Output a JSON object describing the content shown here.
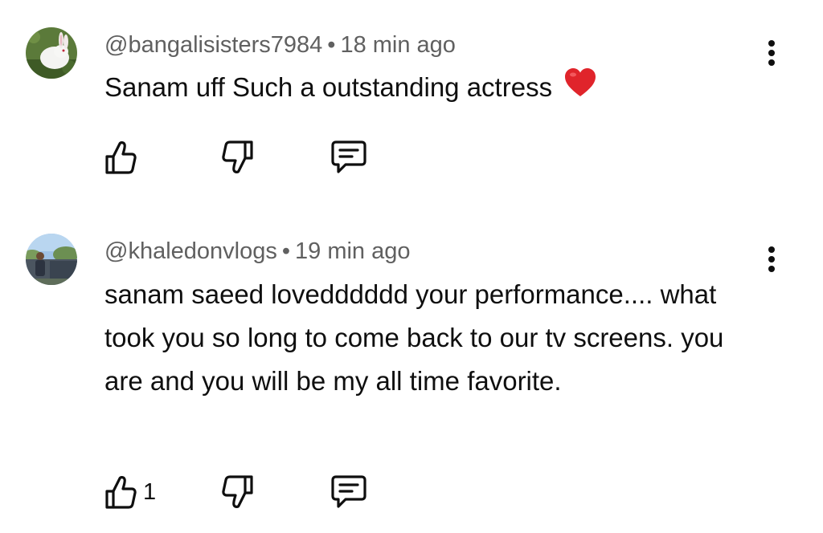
{
  "comments": [
    {
      "username": "@bangalisisters7984",
      "separator": "•",
      "time": "18 min ago",
      "text": "Sanam uff Such a outstanding actress",
      "emoji": "❤️",
      "likes": ""
    },
    {
      "username": "@khaledonvlogs",
      "separator": "•",
      "time": "19 min ago",
      "text": "sanam saeed lovedddddd your performance.... what took you so long to come back to our tv screens. you are and you will be my all time favorite.",
      "emoji": "",
      "likes": "1"
    }
  ],
  "icons": {
    "like": "thumbs-up-icon",
    "dislike": "thumbs-down-icon",
    "reply": "reply-comment-icon",
    "more": "more-vertical-icon"
  },
  "colors": {
    "text": "#0f0f0f",
    "meta": "#606060",
    "heart": "#e0242b"
  }
}
